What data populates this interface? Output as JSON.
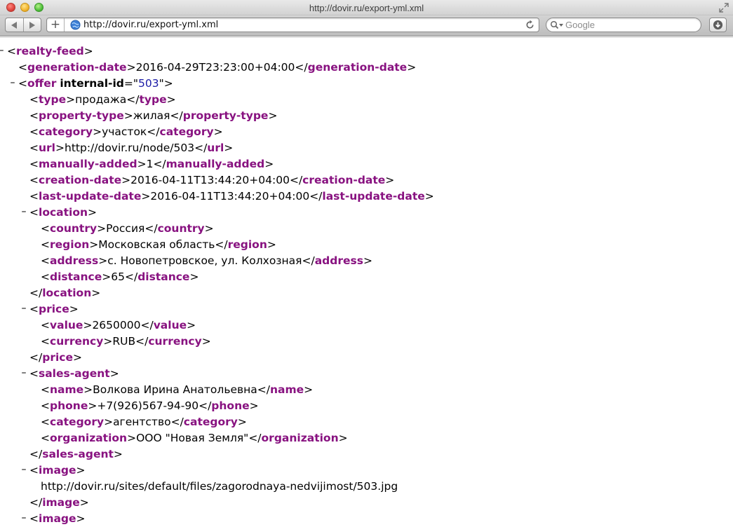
{
  "window": {
    "title": "http://dovir.ru/export-yml.xml"
  },
  "toolbar": {
    "add_label": "+",
    "url": "http://dovir.ru/export-yml.xml",
    "search_placeholder": "Google"
  },
  "xml": {
    "fold_symbol": "–",
    "lines": [
      {
        "indent": 0,
        "fold": true,
        "open": "realty-feed"
      },
      {
        "indent": 1,
        "fold": false,
        "open": "generation-date",
        "text": "2016-04-29T23:23:00+04:00",
        "close": "generation-date"
      },
      {
        "indent": 1,
        "fold": true,
        "open": "offer",
        "attr_name": "internal-id",
        "attr_value": "503"
      },
      {
        "indent": 2,
        "fold": false,
        "open": "type",
        "text": "продажа",
        "close": "type"
      },
      {
        "indent": 2,
        "fold": false,
        "open": "property-type",
        "text": "жилая",
        "close": "property-type"
      },
      {
        "indent": 2,
        "fold": false,
        "open": "category",
        "text": "участок",
        "close": "category"
      },
      {
        "indent": 2,
        "fold": false,
        "open": "url",
        "text": "http://dovir.ru/node/503",
        "close": "url"
      },
      {
        "indent": 2,
        "fold": false,
        "open": "manually-added",
        "text": "1",
        "close": "manually-added"
      },
      {
        "indent": 2,
        "fold": false,
        "open": "creation-date",
        "text": "2016-04-11T13:44:20+04:00",
        "close": "creation-date"
      },
      {
        "indent": 2,
        "fold": false,
        "open": "last-update-date",
        "text": "2016-04-11T13:44:20+04:00",
        "close": "last-update-date"
      },
      {
        "indent": 2,
        "fold": true,
        "open": "location"
      },
      {
        "indent": 3,
        "fold": false,
        "open": "country",
        "text": "Россия",
        "close": "country"
      },
      {
        "indent": 3,
        "fold": false,
        "open": "region",
        "text": "Московская область",
        "close": "region"
      },
      {
        "indent": 3,
        "fold": false,
        "open": "address",
        "text": "с. Новопетровское, ул. Колхозная",
        "close": "address"
      },
      {
        "indent": 3,
        "fold": false,
        "open": "distance",
        "text": "65",
        "close": "distance"
      },
      {
        "indent": 2,
        "fold": false,
        "close": "location"
      },
      {
        "indent": 2,
        "fold": true,
        "open": "price"
      },
      {
        "indent": 3,
        "fold": false,
        "open": "value",
        "text": "2650000",
        "close": "value"
      },
      {
        "indent": 3,
        "fold": false,
        "open": "currency",
        "text": "RUB",
        "close": "currency"
      },
      {
        "indent": 2,
        "fold": false,
        "close": "price"
      },
      {
        "indent": 2,
        "fold": true,
        "open": "sales-agent"
      },
      {
        "indent": 3,
        "fold": false,
        "open": "name",
        "text": "Волкова Ирина Анатольевна",
        "close": "name"
      },
      {
        "indent": 3,
        "fold": false,
        "open": "phone",
        "text": "+7(926)567-94-90",
        "close": "phone"
      },
      {
        "indent": 3,
        "fold": false,
        "open": "category",
        "text": "агентство",
        "close": "category"
      },
      {
        "indent": 3,
        "fold": false,
        "open": "organization",
        "text": "ООО \"Новая Земля\"",
        "close": "organization"
      },
      {
        "indent": 2,
        "fold": false,
        "close": "sales-agent"
      },
      {
        "indent": 2,
        "fold": true,
        "open": "image"
      },
      {
        "indent": 3,
        "fold": false,
        "text": "http://dovir.ru/sites/default/files/zagorodnaya-nedvijimost/503.jpg"
      },
      {
        "indent": 2,
        "fold": false,
        "close": "image"
      },
      {
        "indent": 2,
        "fold": true,
        "open": "image"
      }
    ]
  },
  "colors": {
    "tag": "#881280",
    "attr_value": "#1a1aa6",
    "text": "#000000"
  }
}
